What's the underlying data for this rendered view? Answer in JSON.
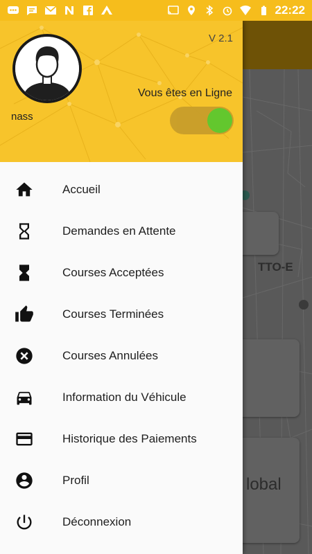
{
  "status_bar": {
    "time": "22:22",
    "left_icons": [
      "messenger-icon",
      "chat-icon",
      "gmail-icon",
      "n-app-icon",
      "facebook-icon",
      "a-app-icon"
    ],
    "right_icons": [
      "cast-icon",
      "location-icon",
      "bluetooth-icon",
      "alarm-icon",
      "wifi-icon",
      "battery-icon"
    ]
  },
  "drawer": {
    "version": "V 2.1",
    "username": "nass",
    "online_label": "Vous êtes en Ligne",
    "online_toggle": true,
    "menu": [
      {
        "label": "Accueil",
        "icon": "home-icon"
      },
      {
        "label": "Demandes en Attente",
        "icon": "hourglass-empty-icon"
      },
      {
        "label": "Courses Acceptées",
        "icon": "hourglass-full-icon"
      },
      {
        "label": "Courses Terminées",
        "icon": "thumb-up-icon"
      },
      {
        "label": "Courses Annulées",
        "icon": "cancel-icon"
      },
      {
        "label": "Information du Véhicule",
        "icon": "car-icon"
      },
      {
        "label": "Historique des Paiements",
        "icon": "credit-card-icon"
      },
      {
        "label": "Profil",
        "icon": "account-circle-icon"
      },
      {
        "label": "Déconnexion",
        "icon": "power-icon"
      }
    ]
  },
  "background": {
    "map_text": "TTO-E",
    "card_text": "lobal"
  },
  "colors": {
    "header_yellow": "#f7c42b",
    "toggle_on": "#5cc82f",
    "status_bar": "#f6bd1c"
  }
}
